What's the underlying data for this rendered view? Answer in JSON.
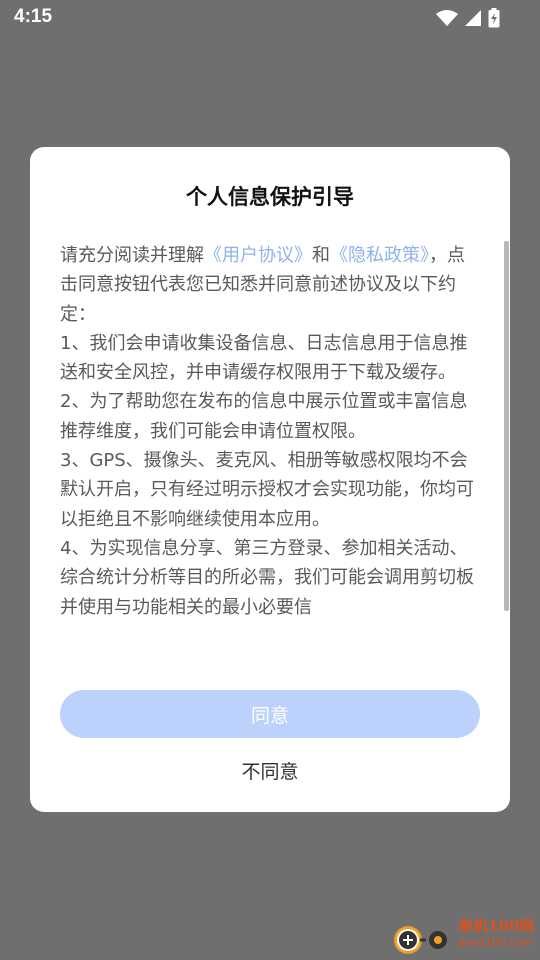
{
  "status_bar": {
    "time": "4:15"
  },
  "dialog": {
    "title": "个人信息保护引导",
    "intro_prefix": "请充分阅读并理解",
    "link_user_agreement": "《用户协议》",
    "and": "和",
    "link_privacy_policy": "《隐私政策》",
    "intro_suffix": "，点击同意按钮代表您已知悉并同意前述协议及以下约定：",
    "item_1": "1、我们会申请收集设备信息、日志信息用于信息推送和安全风控，并申请缓存权限用于下载及缓存。",
    "item_2": "2、为了帮助您在发布的信息中展示位置或丰富信息推荐维度，我们可能会申请位置权限。",
    "item_3": "3、GPS、摄像头、麦克风、相册等敏感权限均不会默认开启，只有经过明示授权才会实现功能，你均可以拒绝且不影响继续使用本应用。",
    "item_4": "4、为实现信息分享、第三方登录、参加相关活动、综合统计分析等目的所必需，我们可能会调用剪切板并使用与功能相关的最小必要信",
    "agree_label": "同意",
    "disagree_label": "不同意"
  },
  "watermark": {
    "name": "单机100网",
    "url": "danji100.com"
  },
  "colors": {
    "backdrop": "#6f6f6f",
    "link": "#8fb2ef",
    "agree_button": "#bcd1fb",
    "watermark": "#d9531e"
  }
}
